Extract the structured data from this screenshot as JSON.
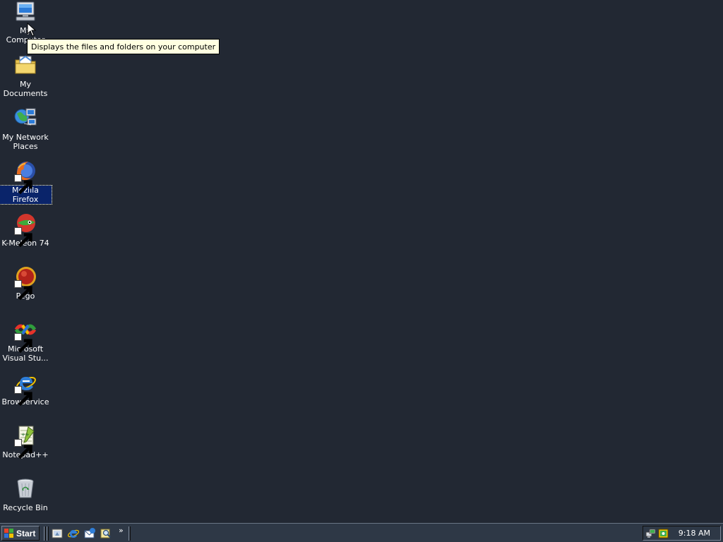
{
  "desktop": {
    "icons": [
      {
        "label": "My Computer",
        "icon": "my-computer-icon"
      },
      {
        "label": "My Documents",
        "icon": "my-documents-icon"
      },
      {
        "label": "My Network\nPlaces",
        "icon": "network-places-icon"
      },
      {
        "label": "Mozilla Firefox",
        "icon": "firefox-icon",
        "selected": true
      },
      {
        "label": "K-Meleon 74",
        "icon": "k-meleon-icon"
      },
      {
        "label": "Pego",
        "icon": "pego-icon"
      },
      {
        "label": "Microsoft\nVisual Stu...",
        "icon": "visual-studio-icon"
      },
      {
        "label": "Browservice",
        "icon": "internet-explorer-icon"
      },
      {
        "label": "Notepad++",
        "icon": "notepad-plus-plus-icon"
      },
      {
        "label": "Recycle Bin",
        "icon": "recycle-bin-icon"
      }
    ],
    "background_color": "#222833",
    "selection_color": "#0a246a"
  },
  "tooltip": {
    "text": "Displays the files and folders on your computer"
  },
  "taskbar": {
    "start_label": "Start",
    "quick_launch": [
      {
        "icon": "show-desktop-icon"
      },
      {
        "icon": "internet-explorer-icon"
      },
      {
        "icon": "outlook-express-icon"
      },
      {
        "icon": "search-icon"
      }
    ],
    "more_label": "»",
    "tray_icons": [
      {
        "icon": "network-tray-icon"
      },
      {
        "icon": "security-tray-icon"
      }
    ],
    "clock": "9:18 AM"
  }
}
